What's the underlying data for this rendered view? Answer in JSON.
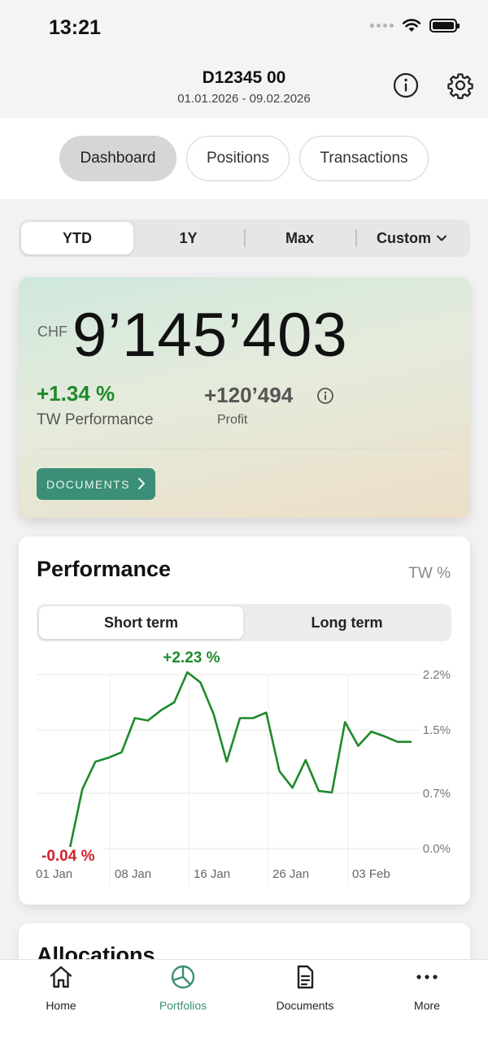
{
  "status_bar": {
    "time": "13:21"
  },
  "header": {
    "title": "D12345 00",
    "date_range": "01.01.2026 - 09.02.2026"
  },
  "main_tabs": [
    {
      "label": "Dashboard",
      "active": true
    },
    {
      "label": "Positions",
      "active": false
    },
    {
      "label": "Transactions",
      "active": false
    }
  ],
  "period_selector": {
    "items": [
      {
        "label": "YTD",
        "active": true
      },
      {
        "label": "1Y",
        "active": false
      },
      {
        "label": "Max",
        "active": false
      },
      {
        "label": "Custom",
        "active": false
      }
    ]
  },
  "summary": {
    "currency": "CHF",
    "value": "9’145’403",
    "performance_value": "+1.34 %",
    "performance_label": "TW Performance",
    "profit_value": "+120’494",
    "profit_label": "Profit",
    "documents_button": "DOCUMENTS"
  },
  "performance": {
    "title": "Performance",
    "unit": "TW %",
    "terms": [
      {
        "label": "Short term",
        "active": true
      },
      {
        "label": "Long term",
        "active": false
      }
    ]
  },
  "chart_data": {
    "type": "line",
    "x": [
      "01 Jan",
      "02 Jan",
      "03 Jan",
      "04 Jan",
      "05 Jan",
      "07 Jan",
      "08 Jan",
      "09 Jan",
      "10 Jan",
      "12 Jan",
      "13 Jan",
      "14 Jan",
      "15 Jan",
      "16 Jan",
      "17 Jan",
      "18 Jan",
      "19 Jan",
      "20 Jan",
      "22 Jan",
      "23 Jan",
      "24 Jan",
      "26 Jan",
      "27 Jan",
      "28 Jan",
      "29 Jan",
      "30 Jan",
      "31 Jan",
      "02 Feb",
      "03 Feb",
      "04 Feb",
      "05 Feb",
      "06 Feb",
      "07 Feb",
      "08 Feb"
    ],
    "series": [
      {
        "values": [
          -0.04,
          0.75,
          1.1,
          1.15,
          1.22,
          1.65,
          1.62,
          1.75,
          1.85,
          2.23,
          2.1,
          1.7,
          1.1,
          1.65,
          1.65,
          1.72,
          0.98,
          0.77,
          1.12,
          0.73,
          0.71,
          1.6,
          1.3,
          1.48,
          1.42,
          1.35,
          1.35
        ]
      }
    ],
    "x_tick_labels": [
      "01 Jan",
      "08 Jan",
      "16 Jan",
      "26 Jan",
      "03 Feb"
    ],
    "y_tick_labels": [
      "2.2%",
      "1.5%",
      "0.7%",
      "0.0%"
    ],
    "y_ticks": [
      2.2,
      1.5,
      0.7,
      0.0
    ],
    "ylim": [
      -0.05,
      2.2
    ],
    "annotations": {
      "max_label": "+2.23 %",
      "min_label": "-0.04 %"
    },
    "grid": true,
    "line_color": "#1e8a2b",
    "max_color": "#1e8a2b",
    "min_color": "#d0202a"
  },
  "allocations": {
    "title": "Allocations"
  },
  "bottom_nav": [
    {
      "label": "Home",
      "icon": "home-icon",
      "active": false
    },
    {
      "label": "Portfolios",
      "icon": "portfolio-pie-icon",
      "active": true
    },
    {
      "label": "Documents",
      "icon": "document-icon",
      "active": false
    },
    {
      "label": "More",
      "icon": "more-dots-icon",
      "active": false
    }
  ],
  "colors": {
    "accent": "#3a8f76",
    "positive": "#1e8a2b",
    "negative": "#d0202a"
  }
}
